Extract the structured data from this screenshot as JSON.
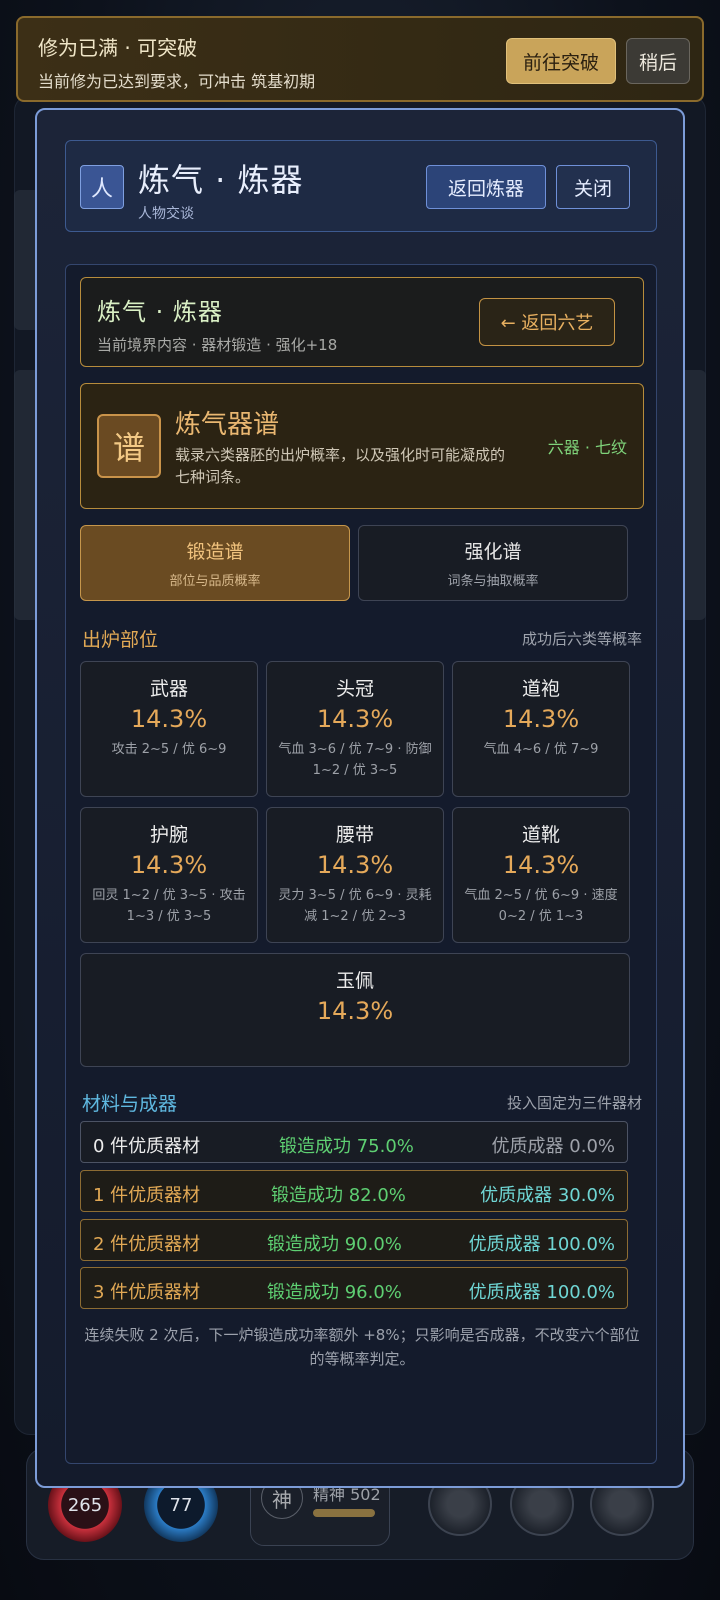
{
  "notice": {
    "title": "修为已满 · 可突破",
    "subtitle": "当前修为已达到要求，可冲击 筑基初期",
    "go_label": "前往突破",
    "later_label": "稍后"
  },
  "background": {
    "hp_value": "265",
    "mp_value": "77",
    "spirit_badge": "神",
    "spirit_label": "精神 502"
  },
  "modal": {
    "char_icon": "人",
    "title": "炼气 · 炼器",
    "subtitle": "人物交谈",
    "back_forge_label": "返回炼器",
    "close_label": "关闭"
  },
  "section": {
    "title": "炼气 · 炼器",
    "subtitle": "当前境界内容 · 器材锻造 · 强化+18",
    "back_label": "← 返回六艺"
  },
  "recipe": {
    "icon_char": "谱",
    "title": "炼气器谱",
    "desc": "载录六类器胚的出炉概率，以及强化时可能凝成的七种词条。",
    "tag": "六器 · 七纹"
  },
  "tabs": [
    {
      "label": "锻造谱",
      "sub": "部位与品质概率",
      "active": true
    },
    {
      "label": "强化谱",
      "sub": "词条与抽取概率",
      "active": false
    }
  ],
  "slots_header": {
    "label": "出炉部位",
    "note": "成功后六类等概率"
  },
  "slots": [
    {
      "name": "武器",
      "percent": "14.3%",
      "desc": "攻击 2~5 / 优 6~9"
    },
    {
      "name": "头冠",
      "percent": "14.3%",
      "desc": "气血 3~6 / 优 7~9 · 防御 1~2 / 优 3~5"
    },
    {
      "name": "道袍",
      "percent": "14.3%",
      "desc": "气血 4~6 / 优 7~9"
    },
    {
      "name": "护腕",
      "percent": "14.3%",
      "desc": "回灵 1~2 / 优 3~5 · 攻击 1~3 / 优 3~5"
    },
    {
      "name": "腰带",
      "percent": "14.3%",
      "desc": "灵力 3~5 / 优 6~9 · 灵耗减 1~2 / 优 2~3"
    },
    {
      "name": "道靴",
      "percent": "14.3%",
      "desc": "气血 2~5 / 优 6~9 · 速度 0~2 / 优 1~3"
    },
    {
      "name": "玉佩",
      "percent": "14.3%",
      "desc": ""
    }
  ],
  "materials_header": {
    "label": "材料与成器",
    "note": "投入固定为三件器材"
  },
  "materials": [
    {
      "count": "0 件优质器材",
      "success": "锻造成功 75.0%",
      "quality": "优质成器 0.0%"
    },
    {
      "count": "1 件优质器材",
      "success": "锻造成功 82.0%",
      "quality": "优质成器 30.0%"
    },
    {
      "count": "2 件优质器材",
      "success": "锻造成功 90.0%",
      "quality": "优质成器 100.0%"
    },
    {
      "count": "3 件优质器材",
      "success": "锻造成功 96.0%",
      "quality": "优质成器 100.0%"
    }
  ],
  "footnote": "连续失败 2 次后，下一炉锻造成功率额外 +8%；只影响是否成器，不改变六个部位的等概率判定。",
  "colors": {
    "accent_gold": "#e5a95a",
    "accent_blue": "#7c9cd8",
    "success_green": "#5ecf72",
    "quality_cyan": "#6fd6d4"
  }
}
